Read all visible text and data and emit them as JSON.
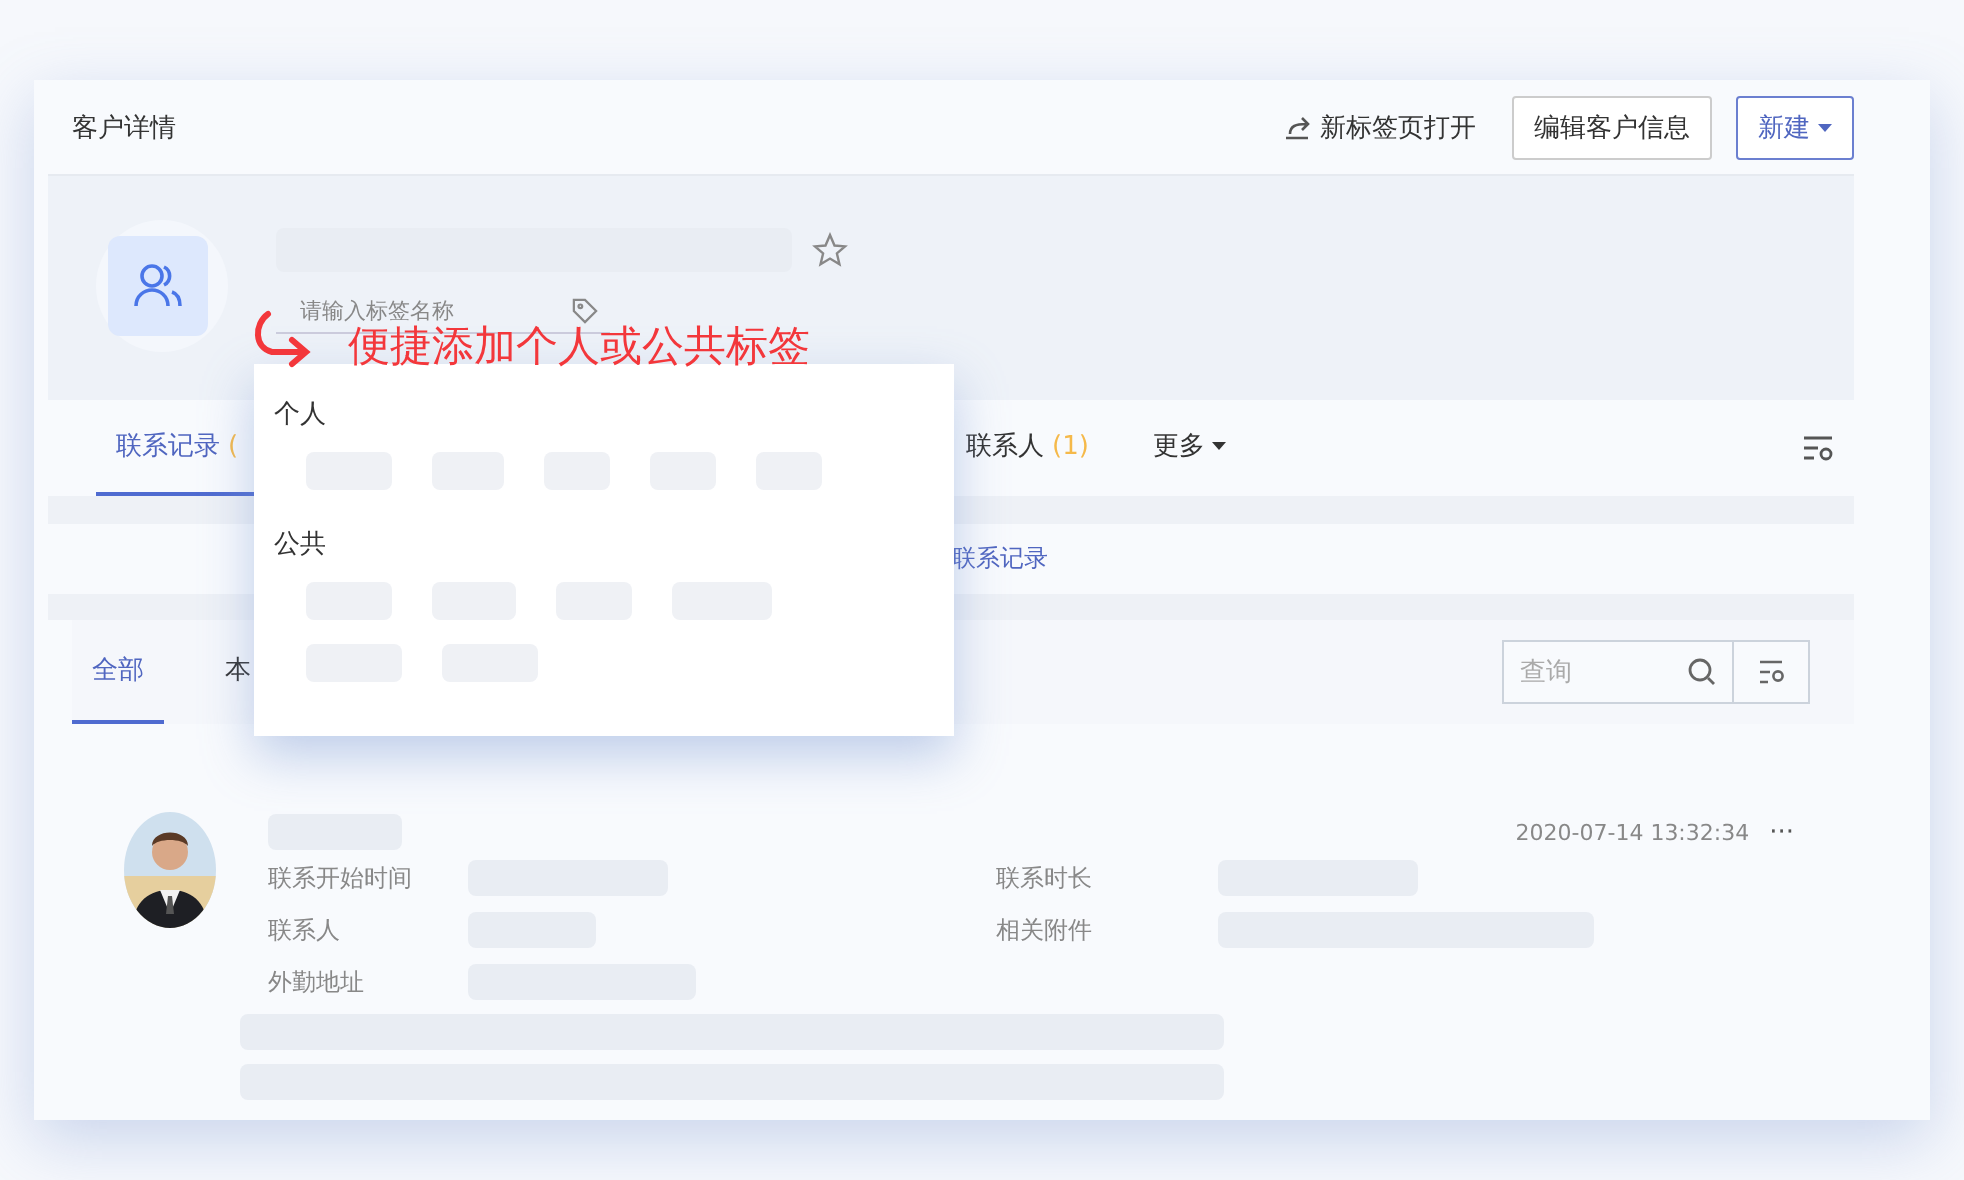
{
  "header": {
    "title": "客户详情",
    "open_link": "新标签页打开",
    "edit_button": "编辑客户信息",
    "new_button": "新建"
  },
  "profile": {
    "tag_field": {
      "placeholder": "请输入标签名称"
    },
    "starred": false
  },
  "annotation": "便捷添加个人或公共标签",
  "tag_popup": {
    "groups": [
      {
        "title": "个人"
      },
      {
        "title": "公共"
      }
    ]
  },
  "tabs": [
    {
      "label": "联系记录",
      "count": "(",
      "selected": true
    },
    {
      "label": "联系人",
      "count": "(1)",
      "selected": false
    }
  ],
  "more_tab": "更多",
  "band_link": "联系记录",
  "subtabs": [
    {
      "label": "全部",
      "selected": true
    },
    {
      "label": "本",
      "selected": false
    }
  ],
  "search": {
    "placeholder": "查询"
  },
  "record": {
    "time": "2020-07-14 13:32:34",
    "menu": "···",
    "fields": [
      {
        "label": "联系开始时间"
      },
      {
        "label": "联系时长"
      },
      {
        "label": "联系人"
      },
      {
        "label": "相关附件"
      },
      {
        "label": "外勤地址"
      }
    ]
  }
}
